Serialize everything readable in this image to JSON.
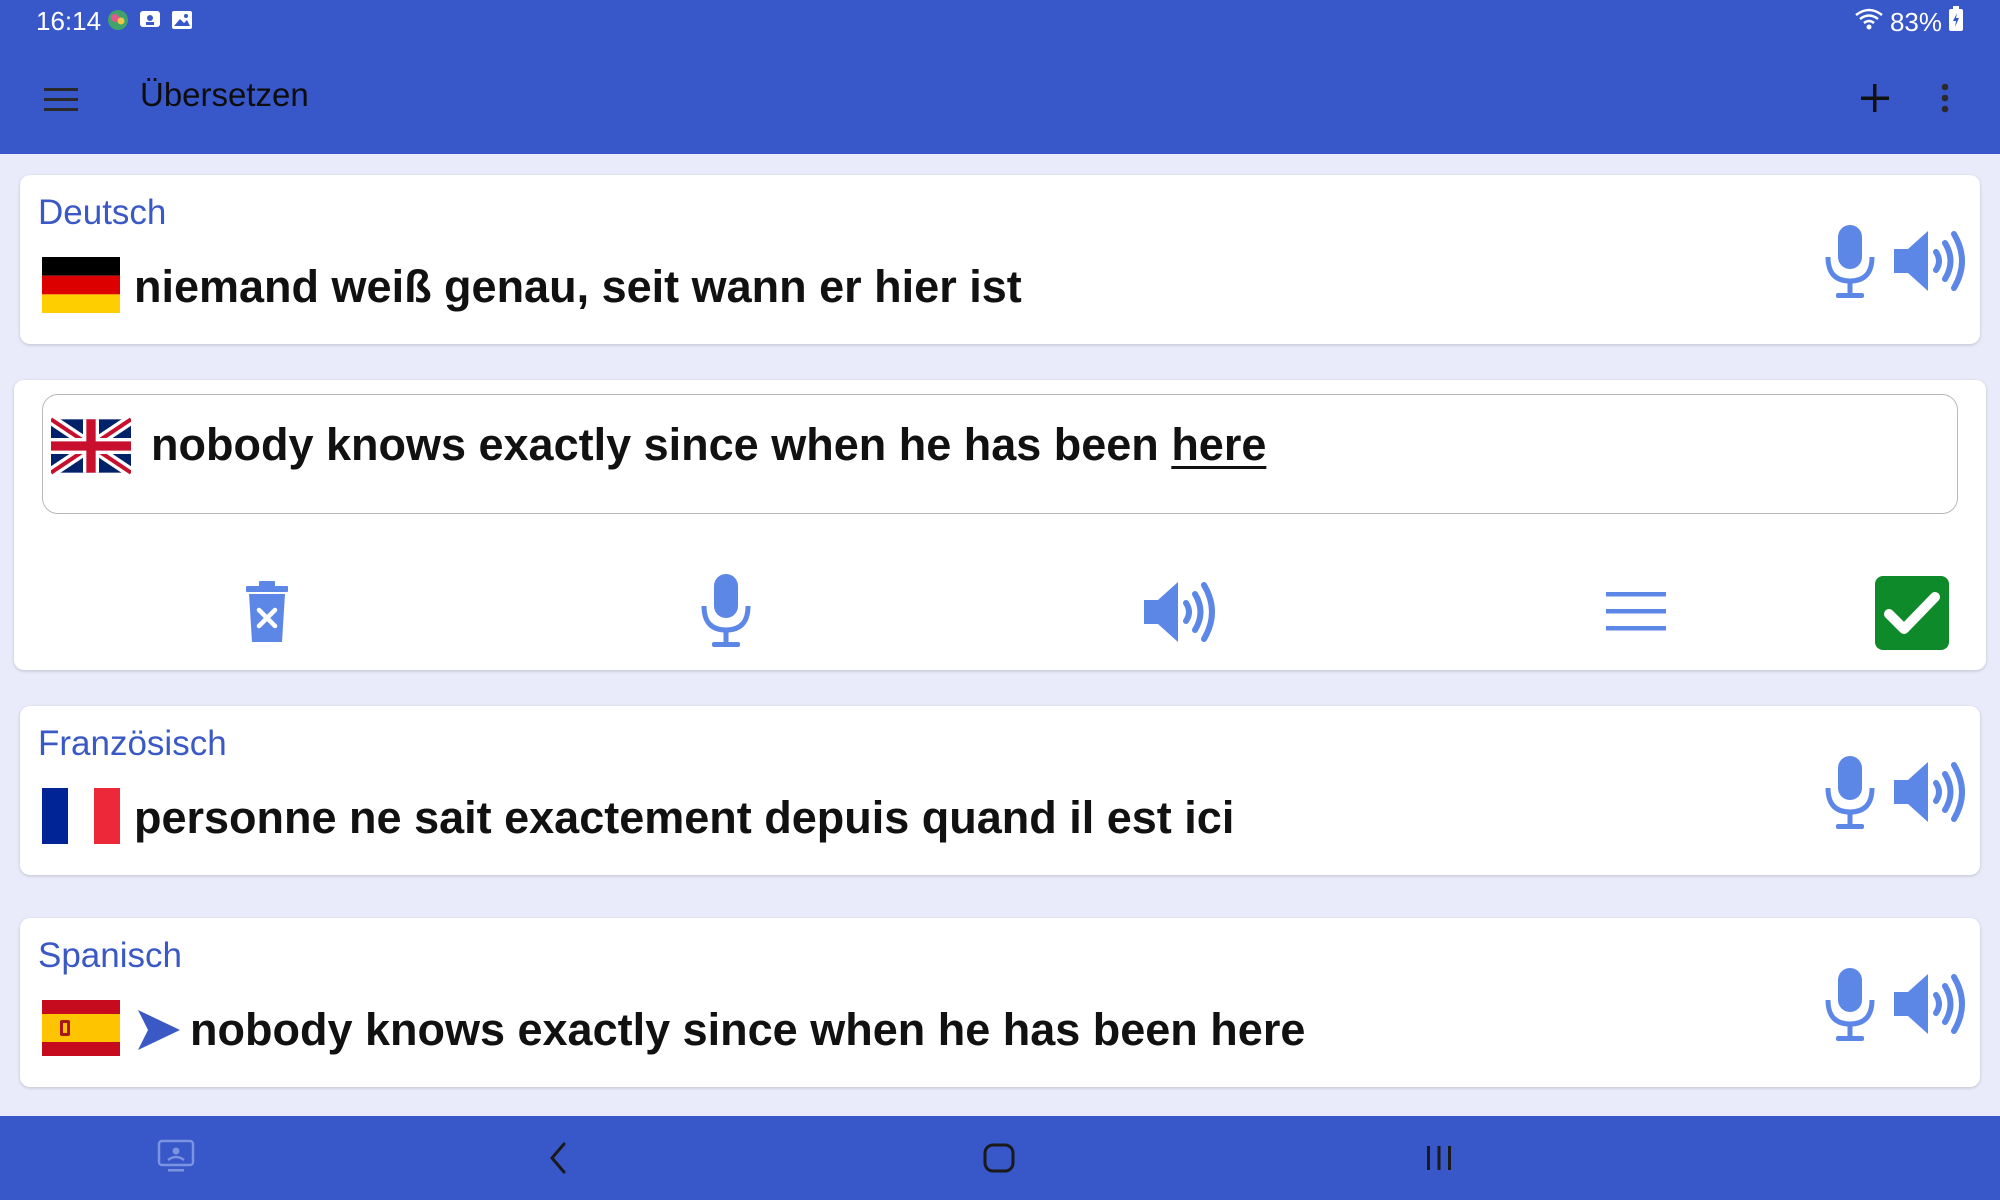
{
  "status_bar": {
    "time": "16:14",
    "battery": "83%"
  },
  "app_bar": {
    "title": "Übersetzen",
    "icons": [
      "menu-icon",
      "plus-icon",
      "more-vert-icon"
    ]
  },
  "cards": {
    "german": {
      "language": "Deutsch",
      "text": "niemand weiß genau, seit wann er hier ist"
    },
    "english": {
      "text_main": "nobody knows exactly since when he has been ",
      "text_underlined": "here"
    },
    "french": {
      "language": "Französisch",
      "text": "personne ne sait exactement depuis quand il est ici"
    },
    "spanish": {
      "language": "Spanisch",
      "text": "nobody knows exactly since when he has been here"
    }
  },
  "colors": {
    "app_bar": "#3857c9",
    "background": "#e9ebfa",
    "accent_blue": "#3b59c4",
    "icon_blue": "#5d87e6",
    "confirm_green": "#0e8a2a"
  }
}
